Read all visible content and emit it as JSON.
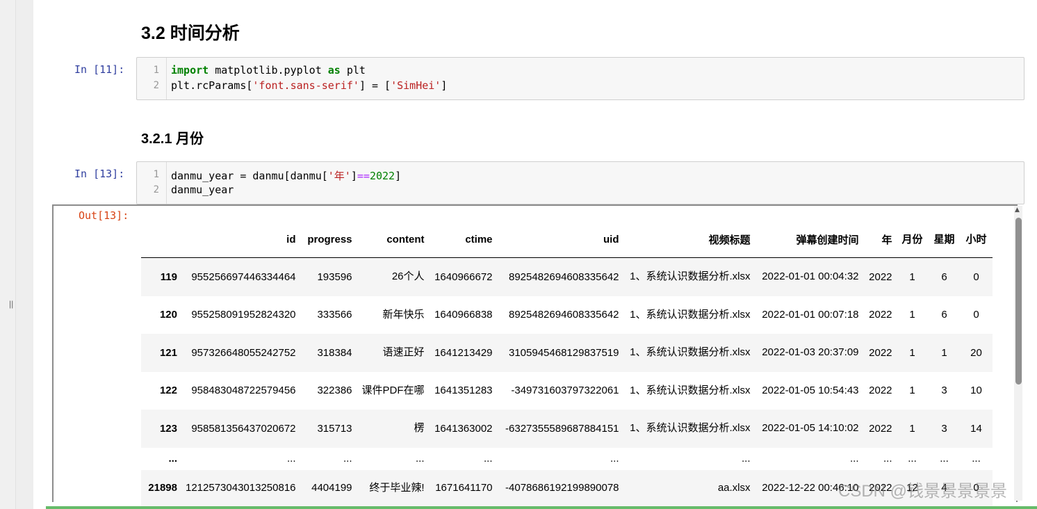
{
  "headings": {
    "section": "3.2  时间分析",
    "subsection": "3.2.1  月份"
  },
  "cell11": {
    "prompt": "In  [11]:",
    "lines": [
      {
        "n": "1",
        "kw": "import",
        "rest": " matplotlib.pyplot ",
        "kw2": "as",
        "rest2": " plt"
      },
      {
        "n": "2",
        "pre": "plt.rcParams[",
        "s1": "'font.sans-serif'",
        "mid": "] = [",
        "s2": "'SimHei'",
        "post": "]"
      }
    ]
  },
  "cell13": {
    "prompt": "In  [13]:",
    "out_prompt": "Out[13]:",
    "lines": [
      {
        "n": "1",
        "pre": "danmu_year = danmu[danmu[",
        "s1": "'年'",
        "mid": "]",
        "op": "==",
        "num": "2022",
        "post": "]"
      },
      {
        "n": "2",
        "text": "danmu_year"
      }
    ]
  },
  "table": {
    "columns": [
      "",
      "id",
      "progress",
      "content",
      "ctime",
      "uid",
      "视频标题",
      "弹幕创建时间",
      "年",
      "月份",
      "星期",
      "小时"
    ],
    "rows": [
      [
        "119",
        "955256697446334464",
        "193596",
        "26个人",
        "1640966672",
        "8925482694608335642",
        "1、系统认识数据分析.xlsx",
        "2022-01-01 00:04:32",
        "2022",
        "1",
        "6",
        "0"
      ],
      [
        "120",
        "955258091952824320",
        "333566",
        "新年快乐",
        "1640966838",
        "8925482694608335642",
        "1、系统认识数据分析.xlsx",
        "2022-01-01 00:07:18",
        "2022",
        "1",
        "6",
        "0"
      ],
      [
        "121",
        "957326648055242752",
        "318384",
        "语速正好",
        "1641213429",
        "3105945468129837519",
        "1、系统认识数据分析.xlsx",
        "2022-01-03 20:37:09",
        "2022",
        "1",
        "1",
        "20"
      ],
      [
        "122",
        "958483048722579456",
        "322386",
        "课件PDF在哪",
        "1641351283",
        "-349731603797322061",
        "1、系统认识数据分析.xlsx",
        "2022-01-05 10:54:43",
        "2022",
        "1",
        "3",
        "10"
      ],
      [
        "123",
        "958581356437020672",
        "315713",
        "楞",
        "1641363002",
        "-6327355589687884151",
        "1、系统认识数据分析.xlsx",
        "2022-01-05 14:10:02",
        "2022",
        "1",
        "3",
        "14"
      ],
      [
        "...",
        "...",
        "...",
        "...",
        "...",
        "...",
        "...",
        "...",
        "...",
        "...",
        "...",
        "..."
      ],
      [
        "21898",
        "1212573043013250816",
        "4404199",
        "终于毕业辣!",
        "1671641170",
        "-4078686192199890078",
        "aa.xlsx",
        "2022-12-22 00:46:10",
        "2022",
        "12",
        "4",
        "0"
      ]
    ]
  },
  "watermark": "CSDN @钱景景景景景",
  "splitter_glyph": "||"
}
